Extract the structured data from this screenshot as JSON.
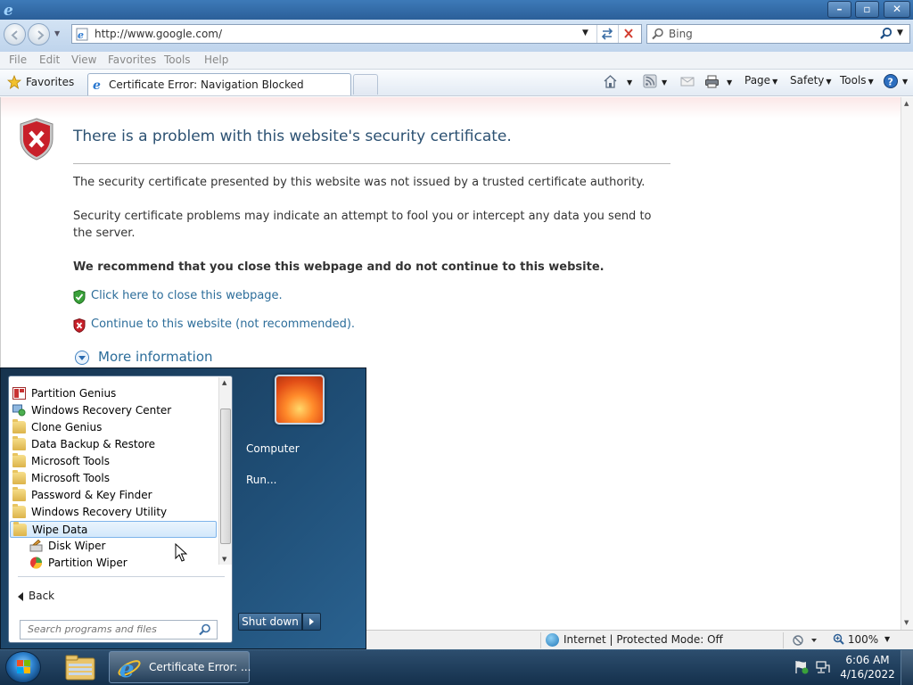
{
  "browser": {
    "address": "http://www.google.com/",
    "search_placeholder": "Bing",
    "menu": [
      "File",
      "Edit",
      "View",
      "Favorites",
      "Tools",
      "Help"
    ],
    "favorites_label": "Favorites",
    "tab_title": "Certificate Error: Navigation Blocked",
    "commands": {
      "page": "Page",
      "safety": "Safety",
      "tools": "Tools"
    }
  },
  "page": {
    "title": "There is a problem with this website's security certificate.",
    "para1": "The security certificate presented by this website was not issued by a trusted certificate authority.",
    "para2": "Security certificate problems may indicate an attempt to fool you or intercept any data you send to the server.",
    "recommend": "We recommend that you close this webpage and do not continue to this website.",
    "link_close": "Click here to close this webpage.",
    "link_continue": "Continue to this website (not recommended).",
    "more_info": "More information"
  },
  "status": {
    "zone": "Internet | Protected Mode: Off",
    "zoom": "100%"
  },
  "start_menu": {
    "items": [
      {
        "label": "Partition Genius",
        "icon": "partition-icon"
      },
      {
        "label": "Windows Recovery Center",
        "icon": "recovery-icon"
      },
      {
        "label": "Clone Genius",
        "icon": "folder-icon"
      },
      {
        "label": "Data Backup & Restore",
        "icon": "folder-icon"
      },
      {
        "label": "Microsoft Tools",
        "icon": "folder-icon"
      },
      {
        "label": "Microsoft Tools",
        "icon": "folder-icon"
      },
      {
        "label": "Password & Key Finder",
        "icon": "folder-icon"
      },
      {
        "label": "Windows Recovery Utility",
        "icon": "folder-icon"
      },
      {
        "label": "Wipe Data",
        "icon": "folder-icon",
        "selected": true
      },
      {
        "label": "Disk Wiper",
        "icon": "disk-wiper-icon"
      },
      {
        "label": "Partition Wiper",
        "icon": "partition-wiper-icon"
      }
    ],
    "back": "Back",
    "search_placeholder": "Search programs and files",
    "right": {
      "computer": "Computer",
      "run": "Run..."
    },
    "shutdown": "Shut down"
  },
  "taskbar": {
    "ie_label": "Certificate Error: ...",
    "time": "6:06 AM",
    "date": "4/16/2022"
  },
  "colors": {
    "title_bar": "#2f669f",
    "link": "#2c6d9a",
    "heading": "#2c5172",
    "start_menu": "#1f4e76",
    "taskbar": "#1c3b5a"
  }
}
